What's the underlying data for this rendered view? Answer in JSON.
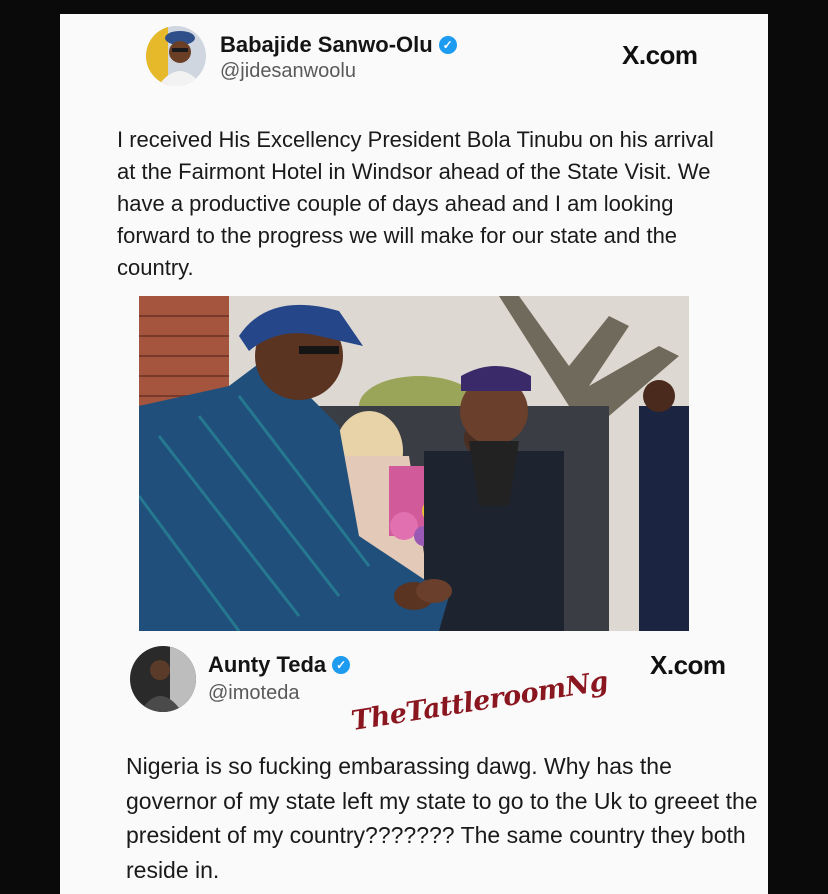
{
  "post1": {
    "display_name": "Babajide Sanwo-Olu",
    "handle": "@jidesanwoolu",
    "source": "X.com",
    "text": "I received His Excellency President Bola Tinubu on his arrival at the Fairmont Hotel in Windsor ahead of the State Visit. We have a productive couple of days ahead and I am looking forward to the progress we will make for our state and the country."
  },
  "post2": {
    "display_name": "Aunty Teda",
    "handle": "@imoteda",
    "source": "X.com",
    "text": "Nigeria is so fucking embarassing dawg. Why has the governor of my state left my state to go to the Uk to greeet the president of my country??????? The same country they both reside in."
  },
  "watermark": "TheTattleroomNg",
  "icons": {
    "verified": "verified-badge-icon"
  },
  "colors": {
    "verified": "#1d9bf0",
    "watermark": "#8a1620"
  }
}
